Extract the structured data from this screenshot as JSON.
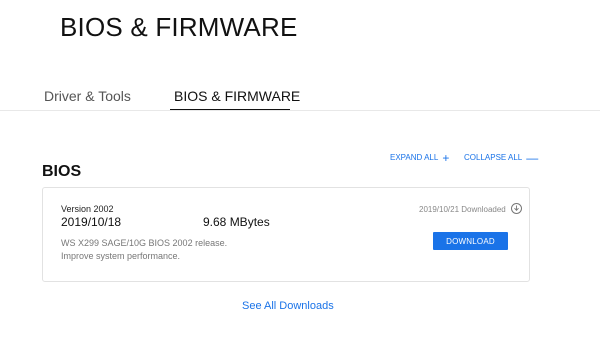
{
  "page_title": "BIOS & FIRMWARE",
  "tabs": [
    {
      "label": "Driver & Tools"
    },
    {
      "label": "BIOS & FIRMWARE",
      "active": true
    }
  ],
  "actions": {
    "expand_all": "EXPAND ALL",
    "expand_symbol": "+",
    "collapse_all": "COLLAPSE ALL",
    "collapse_symbol": "—"
  },
  "section": {
    "title": "BIOS",
    "item": {
      "version": "Version 2002",
      "date": "2019/10/18",
      "size": "9.68 MBytes",
      "description_lines": [
        "WS X299 SAGE/10G BIOS 2002 release.",
        "Improve system performance."
      ],
      "download_status": "2019/10/21 Downloaded",
      "status_icon": "download-circle-icon",
      "download_label": "DOWNLOAD"
    }
  },
  "see_all": "See All Downloads",
  "colors": {
    "accent": "#1a73e8",
    "text": "#111111",
    "muted": "#777777",
    "border": "#e2e2e2"
  }
}
